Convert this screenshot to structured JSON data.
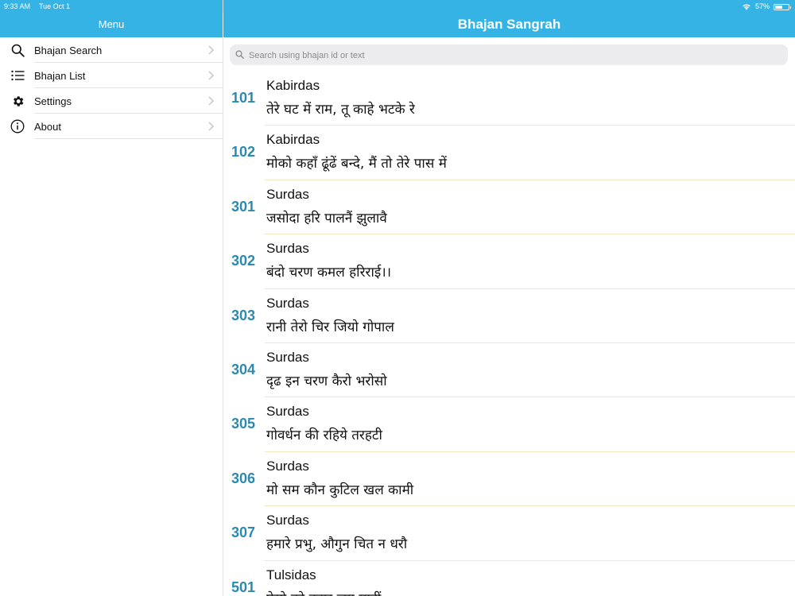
{
  "status": {
    "time": "9:33 AM",
    "date": "Tue Oct 1",
    "battery": "57%",
    "battery_level": 0.57
  },
  "sidebar": {
    "title": "Menu",
    "items": [
      {
        "label": "Bhajan Search",
        "icon": "search-icon"
      },
      {
        "label": "Bhajan List",
        "icon": "list-icon"
      },
      {
        "label": "Settings",
        "icon": "gear-icon"
      },
      {
        "label": "About",
        "icon": "info-icon"
      }
    ]
  },
  "header": {
    "title": "Bhajan Sangrah"
  },
  "search": {
    "placeholder": "Search using bhajan id or text",
    "value": ""
  },
  "bhajans": [
    {
      "id": "101",
      "author": "Kabirdas",
      "title": "तेरे घट में राम, तू काहे भटके रे"
    },
    {
      "id": "102",
      "author": "Kabirdas",
      "title": "मोको कहाँ ढूंढें बन्दे, मैं तो तेरे पास में"
    },
    {
      "id": "301",
      "author": "Surdas",
      "title": "जसोदा हरि पालनैं झुलावै"
    },
    {
      "id": "302",
      "author": "Surdas",
      "title": "बंदो चरण कमल हरिराई।।"
    },
    {
      "id": "303",
      "author": "Surdas",
      "title": "रानी तेरो चिर जियो गोपाल"
    },
    {
      "id": "304",
      "author": "Surdas",
      "title": "दृढ इन चरण कैरो भरोसो"
    },
    {
      "id": "305",
      "author": "Surdas",
      "title": "गोवर्धन की रहिये तरहटी"
    },
    {
      "id": "306",
      "author": "Surdas",
      "title": "मो सम कौन कुटिल खल कामी"
    },
    {
      "id": "307",
      "author": "Surdas",
      "title": "हमारे प्रभु, औगुन चित न धरौ"
    },
    {
      "id": "501",
      "author": "Tulsidas",
      "title": "ऐसो को उदार जग माहीं"
    }
  ],
  "colors": {
    "header_bg": "#34b3e4",
    "id_color": "#2a8aaf",
    "row_separator": "#f6e6c0"
  }
}
